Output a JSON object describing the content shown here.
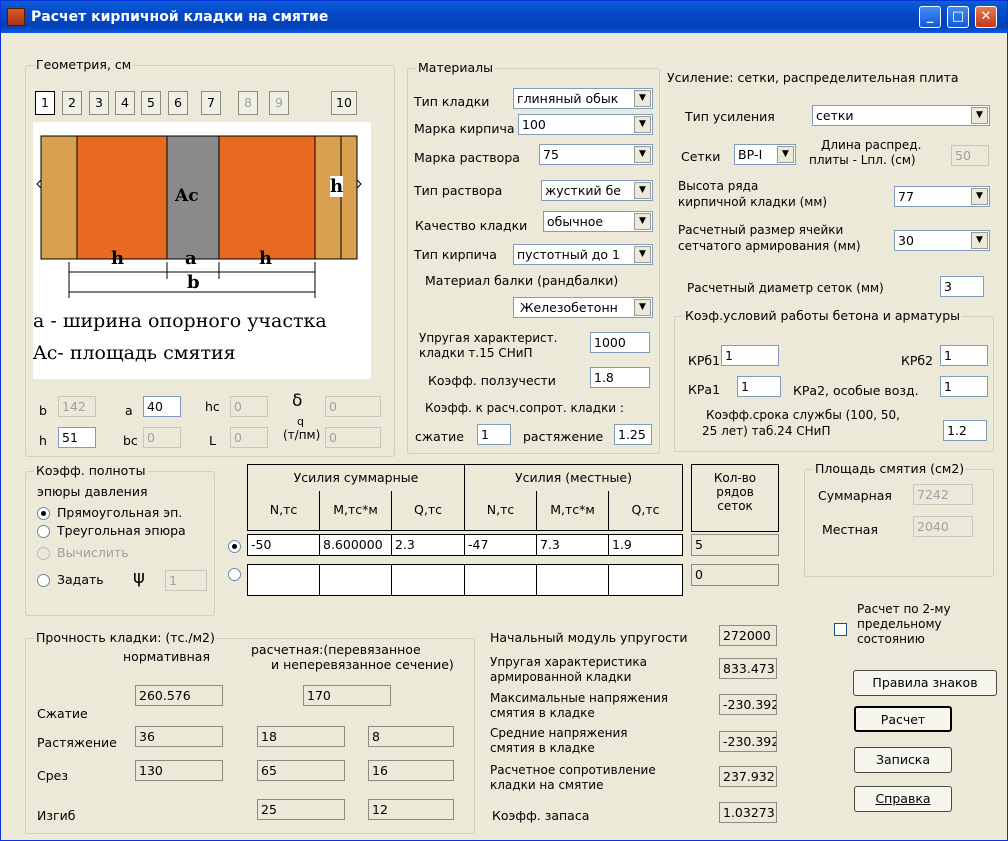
{
  "title": "Расчет кирпичной кладки на смятие",
  "geometry": {
    "group_label": "Геометрия, см",
    "tabs": [
      "1",
      "2",
      "3",
      "4",
      "5",
      "6",
      "7",
      "8",
      "9",
      "10"
    ],
    "diagram": {
      "ac": "Ac",
      "h_right": "h",
      "dim_h1": "h",
      "dim_a": "a",
      "dim_h2": "h",
      "dim_b": "b",
      "caption1": "a - ширина опорного участка",
      "caption2": "Ac- площадь смятия"
    },
    "b_label": "b",
    "b_value": "142",
    "a_label": "a",
    "a_value": "40",
    "hc_label": "hc",
    "hc_value": "0",
    "delta_label": "δ",
    "delta_value": "0",
    "h_label": "h",
    "h_value": "51",
    "bc_label": "bc",
    "bc_value": "0",
    "L_label": "L",
    "L_value": "0",
    "q_label": "q",
    "q_unit": "(т/пм)",
    "q_value": "0"
  },
  "materials": {
    "group_label": "Материалы",
    "masonry_type_label": "Тип кладки",
    "masonry_type": "глиняный обык",
    "brick_grade_label": "Марка кирпича",
    "brick_grade": "100",
    "mortar_grade_label": "Марка раствора",
    "mortar_grade": "75",
    "mortar_type_label": "Тип раствора",
    "mortar_type": "жусткий бе",
    "quality_label": "Качество кладки",
    "quality": "обычное",
    "brick_type_label": "Тип кирпича",
    "brick_type": "пустотный до 1",
    "beam_material_label": "Материал балки  (рандбалки)",
    "beam_material": "Железобетонн",
    "elastic_label1": "Упругая характерист.",
    "elastic_label2": "кладки т.15 СНиП",
    "elastic_value": "1000",
    "creep_label": "Коэфф. ползучести",
    "creep_value": "1.8",
    "resist_coef_label": "Коэфф. к расч.сопрот. кладки :",
    "compression_label": "сжатие",
    "compression_value": "1",
    "tension_label": "растяжение",
    "tension_value": "1.25"
  },
  "reinforcement": {
    "header": "Усиление: сетки,  распределительная плита",
    "type_label": "Тип  усиления",
    "type_value": "сетки",
    "mesh_label": "Сетки",
    "mesh_value": "ВР-I",
    "plate_len_label1": "Длина распред.",
    "plate_len_label2": "плиты - Lпл. (см)",
    "plate_len_value": "50",
    "row_height_label1": "Высота ряда",
    "row_height_label2": "кирпичной кладки (мм)",
    "row_height_value": "77",
    "cell_size_label1": "Расчетный размер ячейки",
    "cell_size_label2": "сетчатого армирования (мм)",
    "cell_size_value": "30",
    "mesh_diam_label": "Расчетный диаметр сеток  (мм)",
    "mesh_diam_value": "3",
    "conditions_group": "Коэф.условий работы бетона и арматуры",
    "kpb1_label": "КРб1",
    "kpb1_value": "1",
    "kpb2_label": "КРб2",
    "kpb2_value": "1",
    "kpa1_label": "КРа1",
    "kpa1_value": "1",
    "kpa2_label": "КРа2, особые возд.",
    "kpa2_value": "1",
    "service_label1": "Коэфф.срока службы (100, 50,",
    "service_label2": "25 лет)  таб.24 СНиП",
    "service_value": "1.2"
  },
  "fullness": {
    "group_label1": "Коэфф. полноты",
    "group_label2": "эпюры давления",
    "opt_rect": "Прямоугольная эп.",
    "opt_tri": "Треугольная эпюра",
    "opt_calc": "Вычислить",
    "opt_set": "Задать",
    "psi_symbol": "ψ",
    "psi_value": "1"
  },
  "forces": {
    "sum_header": "Усилия суммарные",
    "local_header": "Усилия (местные)",
    "columns": [
      "N,тс",
      "М,тс*м",
      "Q,тс",
      "N,тс",
      "М,тс*м",
      "Q,тс"
    ],
    "rows": [
      [
        "-50",
        "8.600000",
        "2.3",
        "-47",
        "7.3",
        "1.9"
      ],
      [
        "",
        "",
        "",
        "",
        "",
        ""
      ]
    ],
    "mesh_rows_header1": "Кол-во",
    "mesh_rows_header2": "рядов",
    "mesh_rows_header3": "сеток",
    "mesh_rows_values": [
      "5",
      "0"
    ]
  },
  "area": {
    "group_label": "Площадь смятия  (см2)",
    "total_label": "Суммарная",
    "total_value": "7242",
    "local_label": "Местная",
    "local_value": "2040"
  },
  "strength": {
    "group_label": "Прочность кладки:  (тс./м2)",
    "normative_label": "нормативная",
    "design_label1": "расчетная:(перевязанное",
    "design_label2": "и неперевязанное сечение)",
    "rows": [
      {
        "label": "Сжатие",
        "norm": "260.576",
        "d1": "170",
        "d2": ""
      },
      {
        "label": "Растяжение",
        "norm": "36",
        "d1": "18",
        "d2": "8"
      },
      {
        "label": "Срез",
        "norm": "130",
        "d1": "65",
        "d2": "16"
      },
      {
        "label": "Изгиб",
        "norm": "",
        "d1": "25",
        "d2": "12"
      }
    ]
  },
  "results": {
    "modulus_label": "Начальный модуль упругости",
    "modulus_value": "272000",
    "elastic_arm_label1": "Упругая характеристика",
    "elastic_arm_label2": "армированной кладки",
    "elastic_arm_value": "833.473",
    "max_stress_label1": "Максимальные напряжения",
    "max_stress_label2": "смятия в кладке",
    "max_stress_value": "-230.392",
    "avg_stress_label1": "Средние напряжения",
    "avg_stress_label2": "смятия в кладке",
    "avg_stress_value": "-230.392",
    "design_res_label1": "Расчетное сопротивление",
    "design_res_label2": "кладки на  смятие",
    "design_res_value": "237.932",
    "safety_label": "Коэфф. запаса",
    "safety_value": "1.03273"
  },
  "actions": {
    "second_state_label1": "Расчет по 2-му",
    "second_state_label2": "предельному",
    "second_state_label3": "состоянию",
    "sign_rules": "Правила знаков",
    "calc": "Расчет",
    "note": "Записка",
    "help": "Справка"
  }
}
